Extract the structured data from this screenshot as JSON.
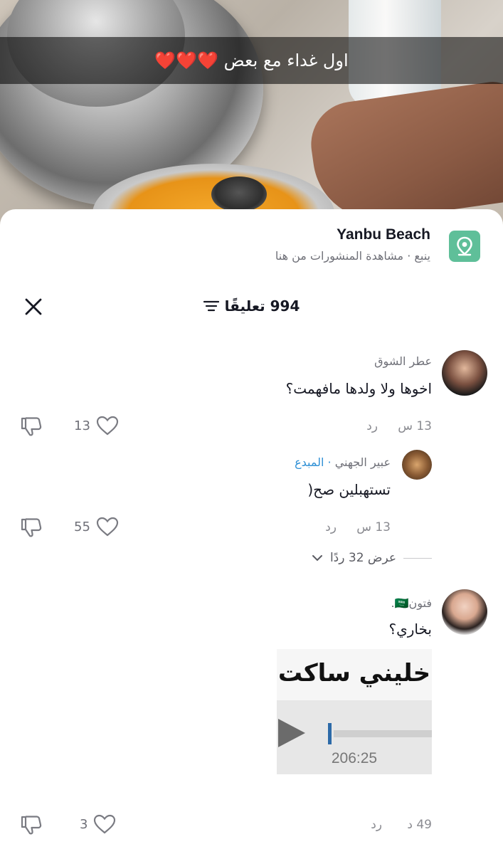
{
  "video": {
    "caption": "اول غداء مع بعض ❤️❤️❤️"
  },
  "location": {
    "title": "Yanbu Beach",
    "subtitle": "ينبع · مشاهدة المنشورات من هنا",
    "icon": "map-pin-icon"
  },
  "comments_header": {
    "count_label": "994 تعليقًا",
    "filter_icon": "sort-icon",
    "close_icon": "close-icon"
  },
  "comments": [
    {
      "name": "عطر الشوق",
      "text": "اخوها ولا ولدها مافهمت؟",
      "time": "13 س",
      "reply": "رد",
      "likes": "13"
    },
    {
      "name": "عبير الجهني",
      "creator_tag": "· المبدع",
      "text": "تستهبلين صح(",
      "time": "13 س",
      "reply": "رد",
      "likes": "55"
    },
    {
      "view_replies": "عرض 32 ردًا"
    },
    {
      "name": "فتون🇸🇦.",
      "text": "بخاري؟",
      "time": "49 د",
      "reply": "رد",
      "likes": "3",
      "sticker": {
        "title": "خليني ساكت",
        "time": "206:25"
      }
    }
  ],
  "colors": {
    "accent": "#2d8fd5",
    "location_icon_bg": "#5fbf99",
    "overlay": "rgba(0,0,0,0.55)"
  }
}
